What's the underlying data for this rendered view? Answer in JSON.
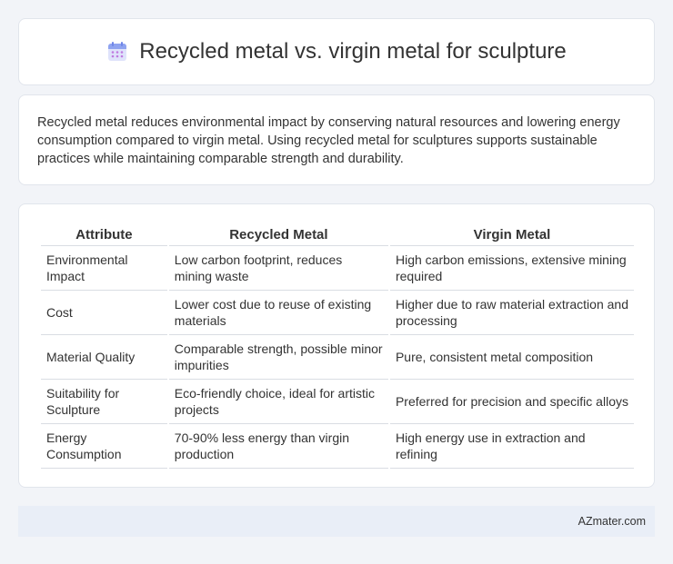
{
  "header": {
    "title": "Recycled metal vs. virgin metal for sculpture",
    "icon": "calendar-icon"
  },
  "intro": {
    "text": "Recycled metal reduces environmental impact by conserving natural resources and lowering energy consumption compared to virgin metal. Using recycled metal for sculptures supports sustainable practices while maintaining comparable strength and durability."
  },
  "table": {
    "headers": [
      "Attribute",
      "Recycled Metal",
      "Virgin Metal"
    ],
    "rows": [
      [
        "Environmental Impact",
        "Low carbon footprint, reduces mining waste",
        "High carbon emissions, extensive mining required"
      ],
      [
        "Cost",
        "Lower cost due to reuse of existing materials",
        "Higher due to raw material extraction and processing"
      ],
      [
        "Material Quality",
        "Comparable strength, possible minor impurities",
        "Pure, consistent metal composition"
      ],
      [
        "Suitability for Sculpture",
        "Eco-friendly choice, ideal for artistic projects",
        "Preferred for precision and specific alloys"
      ],
      [
        "Energy Consumption",
        "70-90% less energy than virgin production",
        "High energy use in extraction and refining"
      ]
    ]
  },
  "footer": {
    "site": "AZmater.com"
  }
}
